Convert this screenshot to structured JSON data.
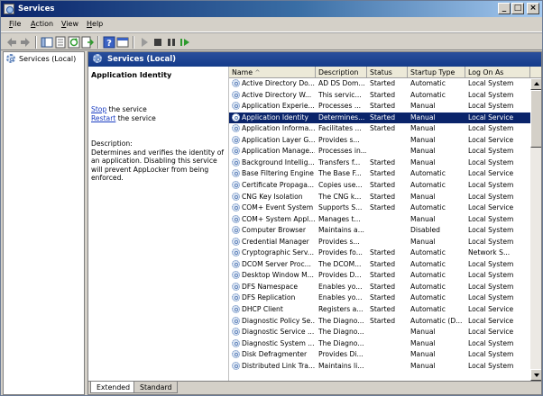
{
  "window": {
    "title": "Services"
  },
  "menu": [
    {
      "key": "F",
      "rest": "ile"
    },
    {
      "key": "A",
      "rest": "ction"
    },
    {
      "key": "V",
      "rest": "iew"
    },
    {
      "key": "H",
      "rest": "elp"
    }
  ],
  "tree": {
    "root_label": "Services (Local)"
  },
  "pane": {
    "header": "Services (Local)",
    "selected_name": "Application Identity",
    "stop_link": "Stop",
    "stop_rest": " the service",
    "restart_link": "Restart",
    "restart_rest": " the service",
    "description_label": "Description:",
    "description_text": "Determines and verifies the identity of an application. Disabling this service will prevent AppLocker from being enforced."
  },
  "columns": {
    "name": "Name",
    "sort_indicator": "^",
    "description": "Description",
    "status": "Status",
    "startup": "Startup Type",
    "logon": "Log On As"
  },
  "services": [
    {
      "name": "Active Directory Do...",
      "desc": "AD DS Dom...",
      "status": "Started",
      "startup": "Automatic",
      "logon": "Local System"
    },
    {
      "name": "Active Directory W...",
      "desc": "This servic...",
      "status": "Started",
      "startup": "Automatic",
      "logon": "Local System"
    },
    {
      "name": "Application Experie...",
      "desc": "Processes ...",
      "status": "Started",
      "startup": "Manual",
      "logon": "Local System"
    },
    {
      "name": "Application Identity",
      "desc": "Determines...",
      "status": "Started",
      "startup": "Manual",
      "logon": "Local Service",
      "selected": true
    },
    {
      "name": "Application Informa...",
      "desc": "Facilitates ...",
      "status": "Started",
      "startup": "Manual",
      "logon": "Local System"
    },
    {
      "name": "Application Layer G...",
      "desc": "Provides s...",
      "status": "",
      "startup": "Manual",
      "logon": "Local Service"
    },
    {
      "name": "Application Manage...",
      "desc": "Processes in...",
      "status": "",
      "startup": "Manual",
      "logon": "Local System"
    },
    {
      "name": "Background Intellig...",
      "desc": "Transfers f...",
      "status": "Started",
      "startup": "Manual",
      "logon": "Local System"
    },
    {
      "name": "Base Filtering Engine",
      "desc": "The Base F...",
      "status": "Started",
      "startup": "Automatic",
      "logon": "Local Service"
    },
    {
      "name": "Certificate Propaga...",
      "desc": "Copies use...",
      "status": "Started",
      "startup": "Automatic",
      "logon": "Local System"
    },
    {
      "name": "CNG Key Isolation",
      "desc": "The CNG k...",
      "status": "Started",
      "startup": "Manual",
      "logon": "Local System"
    },
    {
      "name": "COM+ Event System",
      "desc": "Supports S...",
      "status": "Started",
      "startup": "Automatic",
      "logon": "Local Service"
    },
    {
      "name": "COM+ System Appl...",
      "desc": "Manages t...",
      "status": "",
      "startup": "Manual",
      "logon": "Local System"
    },
    {
      "name": "Computer Browser",
      "desc": "Maintains a...",
      "status": "",
      "startup": "Disabled",
      "logon": "Local System"
    },
    {
      "name": "Credential Manager",
      "desc": "Provides s...",
      "status": "",
      "startup": "Manual",
      "logon": "Local System"
    },
    {
      "name": "Cryptographic Serv...",
      "desc": "Provides fo...",
      "status": "Started",
      "startup": "Automatic",
      "logon": "Network S..."
    },
    {
      "name": "DCOM Server Proc...",
      "desc": "The DCOM...",
      "status": "Started",
      "startup": "Automatic",
      "logon": "Local System"
    },
    {
      "name": "Desktop Window M...",
      "desc": "Provides D...",
      "status": "Started",
      "startup": "Automatic",
      "logon": "Local System"
    },
    {
      "name": "DFS Namespace",
      "desc": "Enables yo...",
      "status": "Started",
      "startup": "Automatic",
      "logon": "Local System"
    },
    {
      "name": "DFS Replication",
      "desc": "Enables yo...",
      "status": "Started",
      "startup": "Automatic",
      "logon": "Local System"
    },
    {
      "name": "DHCP Client",
      "desc": "Registers a...",
      "status": "Started",
      "startup": "Automatic",
      "logon": "Local Service"
    },
    {
      "name": "Diagnostic Policy Se...",
      "desc": "The Diagno...",
      "status": "Started",
      "startup": "Automatic (D...",
      "logon": "Local Service"
    },
    {
      "name": "Diagnostic Service ...",
      "desc": "The Diagno...",
      "status": "",
      "startup": "Manual",
      "logon": "Local Service"
    },
    {
      "name": "Diagnostic System ...",
      "desc": "The Diagno...",
      "status": "",
      "startup": "Manual",
      "logon": "Local System"
    },
    {
      "name": "Disk Defragmenter",
      "desc": "Provides Di...",
      "status": "",
      "startup": "Manual",
      "logon": "Local System"
    },
    {
      "name": "Distributed Link Tra...",
      "desc": "Maintains li...",
      "status": "",
      "startup": "Manual",
      "logon": "Local System"
    }
  ],
  "tabs": [
    "Extended",
    "Standard"
  ]
}
